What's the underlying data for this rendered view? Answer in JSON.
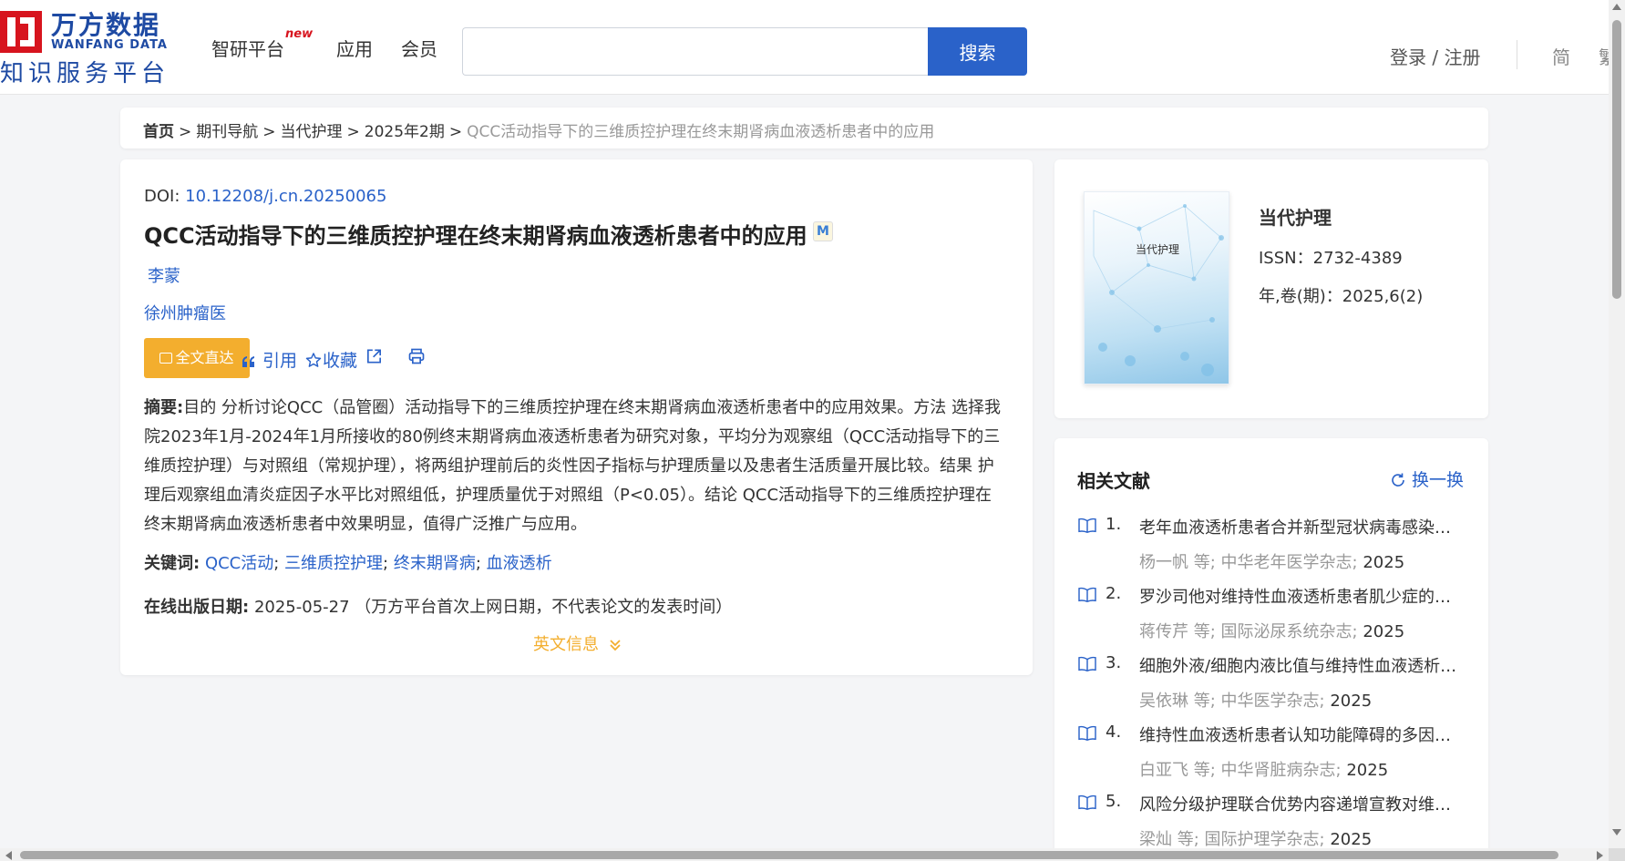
{
  "header": {
    "logo": {
      "cn": "万方数据",
      "en": "WANFANG DATA",
      "sub": "知识服务平台"
    },
    "nav": [
      {
        "label": "智研平台",
        "badge": "new"
      },
      {
        "label": "应用"
      },
      {
        "label": "会员"
      }
    ],
    "search": {
      "value": "",
      "placeholder": "",
      "button": "搜索"
    },
    "login": "登录 / 注册",
    "lang_simp": "简",
    "lang_trad": "繁"
  },
  "breadcrumb": {
    "home": "首页",
    "items": [
      "期刊导航",
      "当代护理",
      "2025年2期"
    ],
    "current": "QCC活动指导下的三维质控护理在终末期肾病血液透析患者中的应用",
    "sep": ">"
  },
  "article": {
    "doi_label": "DOI:",
    "doi": "10.12208/j.cn.20250065",
    "title": "QCC活动指导下的三维质控护理在终末期肾病血液透析患者中的应用",
    "badge": "M",
    "author": "李蒙",
    "affiliation": "徐州肿瘤医",
    "actions": {
      "fulltext": "全文直达",
      "cite": "引用",
      "favorite": "收藏"
    },
    "abstract_label": "摘要:",
    "abstract": "目的 分析讨论QCC（品管圈）活动指导下的三维质控护理在终末期肾病血液透析患者中的应用效果。方法 选择我院2023年1月-2024年1月所接收的80例终末期肾病血液透析患者为研究对象，平均分为观察组（QCC活动指导下的三维质控护理）与对照组（常规护理），将两组护理前后的炎性因子指标与护理质量以及患者生活质量开展比较。结果 护理后观察组血清炎症因子水平比对照组低，护理质量优于对照组（P<0.05）。结论 QCC活动指导下的三维质控护理在终末期肾病血液透析患者中效果明显，值得广泛推广与应用。",
    "keywords_label": "关键词:",
    "keywords": [
      "QCC活动",
      "三维质控护理",
      "终末期肾病",
      "血液透析"
    ],
    "pubdate_label": "在线出版日期:",
    "pubdate": "2025-05-27",
    "pubdate_note": "（万方平台首次上网日期，不代表论文的发表时间）",
    "english_info": "英文信息"
  },
  "journal": {
    "cover_title": "当代护理",
    "name": "当代护理",
    "issn": "ISSN：2732-4389",
    "volume": "年,卷(期)：2025,6(2)"
  },
  "related": {
    "heading": "相关文献",
    "refresh": "换一换",
    "items": [
      {
        "num": "1.",
        "title": "老年血液透析患者合并新型冠状病毒感染后...",
        "author": "杨一帆",
        "etal": "等;",
        "journal": "中华老年医学杂志",
        "year": "2025"
      },
      {
        "num": "2.",
        "title": "罗沙司他对维持性血液透析患者肌少症的影...",
        "author": "蒋传芹",
        "etal": "等;",
        "journal": "国际泌尿系统杂志",
        "year": "2025"
      },
      {
        "num": "3.",
        "title": "细胞外液/细胞内液比值与维持性血液透析患...",
        "author": "吴依琳",
        "etal": "等;",
        "journal": "中华医学杂志",
        "year": "2025"
      },
      {
        "num": "4.",
        "title": "维持性血液透析患者认知功能障碍的多因素...",
        "author": "白亚飞",
        "etal": "等;",
        "journal": "中华肾脏病杂志",
        "year": "2025"
      },
      {
        "num": "5.",
        "title": "风险分级护理联合优势内容递增宣教对维持...",
        "author": "梁灿",
        "etal": "等;",
        "journal": "国际护理学杂志",
        "year": "2025"
      }
    ]
  },
  "colors": {
    "brand_blue": "#2a62c9",
    "logo_red": "#d7141e",
    "accent_orange": "#f3ae2e"
  }
}
